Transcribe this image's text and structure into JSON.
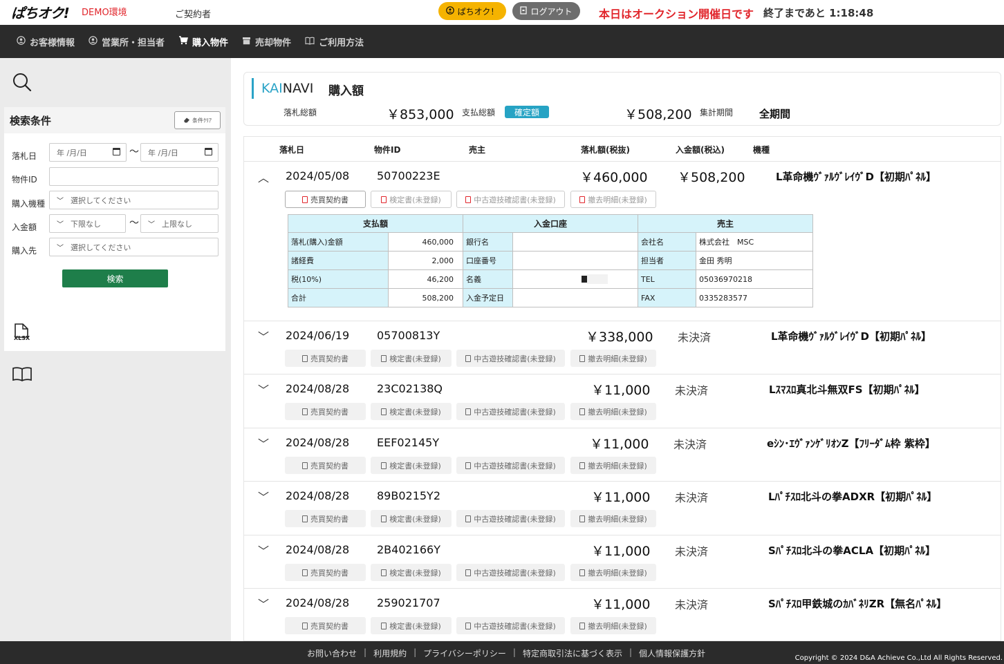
{
  "header": {
    "logo": "ぱちオク!",
    "env": "DEMO環境",
    "contractor": "ご契約者",
    "pachi_button": "ぱちオク！",
    "logout_button": "ログアウト",
    "auction_notice": "本日はオークション開催日です",
    "countdown": "終了まであと 1:18:48"
  },
  "nav": {
    "items": [
      {
        "label": "お客様情報",
        "icon": "user-circle-icon"
      },
      {
        "label": "営業所・担当者",
        "icon": "user-circle-icon"
      },
      {
        "label": "購入物件",
        "icon": "cart-icon"
      },
      {
        "label": "売却物件",
        "icon": "box-icon"
      },
      {
        "label": "ご利用方法",
        "icon": "book-icon"
      }
    ],
    "active": "購入物件"
  },
  "search": {
    "title": "検索条件",
    "clear_label": "条件ｸﾘｱ",
    "date_label": "落札日",
    "date_from": "年 /月/日",
    "date_to": "年 /月/日",
    "tilde": "〜",
    "item_id_label": "物件ID",
    "model_label": "購入機種",
    "model_placeholder": "選択してください",
    "payment_label": "入金額",
    "payment_min": "下限なし",
    "payment_max": "上限なし",
    "supplier_label": "購入先",
    "supplier_placeholder": "選択してください",
    "search_button": "検索",
    "xlsx_label": "XLSX"
  },
  "summary": {
    "brand_kai": "KAI",
    "brand_navi": "NAVI",
    "title": "購入額",
    "bid_total_label": "落札総額",
    "bid_total_value": "￥853,000",
    "pay_total_label": "支払総額",
    "pay_badge": "確定額",
    "pay_total_value": "￥508,200",
    "period_label": "集計期間",
    "period_value": "全期間"
  },
  "list": {
    "headers": [
      "落札日",
      "物件ID",
      "売主",
      "落札額(税抜)",
      "入金額(税込)",
      "機種"
    ],
    "doc_buttons": [
      "売買契約書",
      "検定書(未登録)",
      "中古遊技確認書(未登録)",
      "撤去明細(未登録)"
    ],
    "rows": [
      {
        "toggle": "︿",
        "date": "2024/05/08",
        "id": "50700223E",
        "amount": "￥460,000",
        "paid": "￥508,200",
        "model": "L革命機ｳﾞｧﾙｳﾞﾚｲｳﾞD【初期ﾊﾟﾈﾙ】",
        "expanded": true
      },
      {
        "toggle": "﹀",
        "date": "2024/06/19",
        "id": "05700813Y",
        "amount": "￥338,000",
        "paid": "未決済",
        "model": "L革命機ｳﾞｧﾙｳﾞﾚｲｳﾞD【初期ﾊﾟﾈﾙ】",
        "expanded": false
      },
      {
        "toggle": "﹀",
        "date": "2024/08/28",
        "id": "23C02138Q",
        "amount": "￥11,000",
        "paid": "未決済",
        "model": "Lｽﾏｽﾛ真北斗無双FS【初期ﾊﾟﾈﾙ】",
        "expanded": false
      },
      {
        "toggle": "﹀",
        "date": "2024/08/28",
        "id": "EEF02145Y",
        "amount": "￥11,000",
        "paid": "未決済",
        "model": "eｼﾝ･ｴｳﾞｧﾝｹﾞﾘｵﾝZ【ﾌﾘｰﾀﾞﾑ枠 紫枠】",
        "expanded": false
      },
      {
        "toggle": "﹀",
        "date": "2024/08/28",
        "id": "89B0215Y2",
        "amount": "￥11,000",
        "paid": "未決済",
        "model": "Lﾊﾟﾁｽﾛ北斗の拳ADXR【初期ﾊﾟﾈﾙ】",
        "expanded": false
      },
      {
        "toggle": "﹀",
        "date": "2024/08/28",
        "id": "2B402166Y",
        "amount": "￥11,000",
        "paid": "未決済",
        "model": "Sﾊﾟﾁｽﾛ北斗の拳ACLA【初期ﾊﾟﾈﾙ】",
        "expanded": false
      },
      {
        "toggle": "﹀",
        "date": "2024/08/28",
        "id": "259021707",
        "amount": "￥11,000",
        "paid": "未決済",
        "model": "Sﾊﾟﾁｽﾛ甲鉄城のｶﾊﾞﾈﾘZR【無名ﾊﾟﾈﾙ】",
        "expanded": false
      }
    ],
    "detail": {
      "col_pay": "支払額",
      "col_account": "入金口座",
      "col_seller": "売主",
      "pay_rows": [
        {
          "label": "落札(購入)金額",
          "value": "460,000"
        },
        {
          "label": "諸経費",
          "value": "2,000"
        },
        {
          "label": "税(10%)",
          "value": "46,200"
        },
        {
          "label": "合計",
          "value": "508,200"
        }
      ],
      "account_rows": [
        {
          "label": "銀行名",
          "value": ""
        },
        {
          "label": "口座番号",
          "value": ""
        },
        {
          "label": "名義",
          "value": ""
        },
        {
          "label": "入金予定日",
          "value": ""
        }
      ],
      "seller_rows": [
        {
          "label": "会社名",
          "value": "株式会社　MSC"
        },
        {
          "label": "担当者",
          "value": "金田 秀明"
        },
        {
          "label": "TEL",
          "value": "05036970218"
        },
        {
          "label": "FAX",
          "value": "0335283577"
        }
      ]
    }
  },
  "footer": {
    "links": [
      "お問い合わせ",
      "利用規約",
      "プライバシーポリシー",
      "特定商取引法に基づく表示",
      "個人情報保護方針"
    ],
    "copyright": "Copyright © 2024 D&A Achieve Co.,Ltd All Rights Reserved."
  }
}
